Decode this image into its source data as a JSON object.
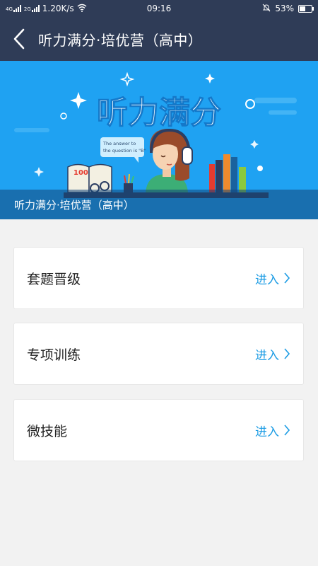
{
  "status_bar": {
    "network_tag_1": "4G",
    "network_tag_2": "2G",
    "speed": "1.20K/s",
    "time": "09:16",
    "battery_text": "53%",
    "battery_level": 0.53
  },
  "header": {
    "title": "听力满分·培优营（高中）"
  },
  "banner": {
    "headline": "听力满分",
    "bubble_line1": "The answer to",
    "bubble_line2": "the question is \"B\"",
    "book_number": "100",
    "caption": "听力满分·培优营（高中）"
  },
  "sections": [
    {
      "title": "套题晋级",
      "action": "进入"
    },
    {
      "title": "专项训练",
      "action": "进入"
    },
    {
      "title": "微技能",
      "action": "进入"
    }
  ],
  "colors": {
    "header_bg": "#2f3c57",
    "banner_bg": "#1fa2f2",
    "accent": "#1c9ce4"
  }
}
